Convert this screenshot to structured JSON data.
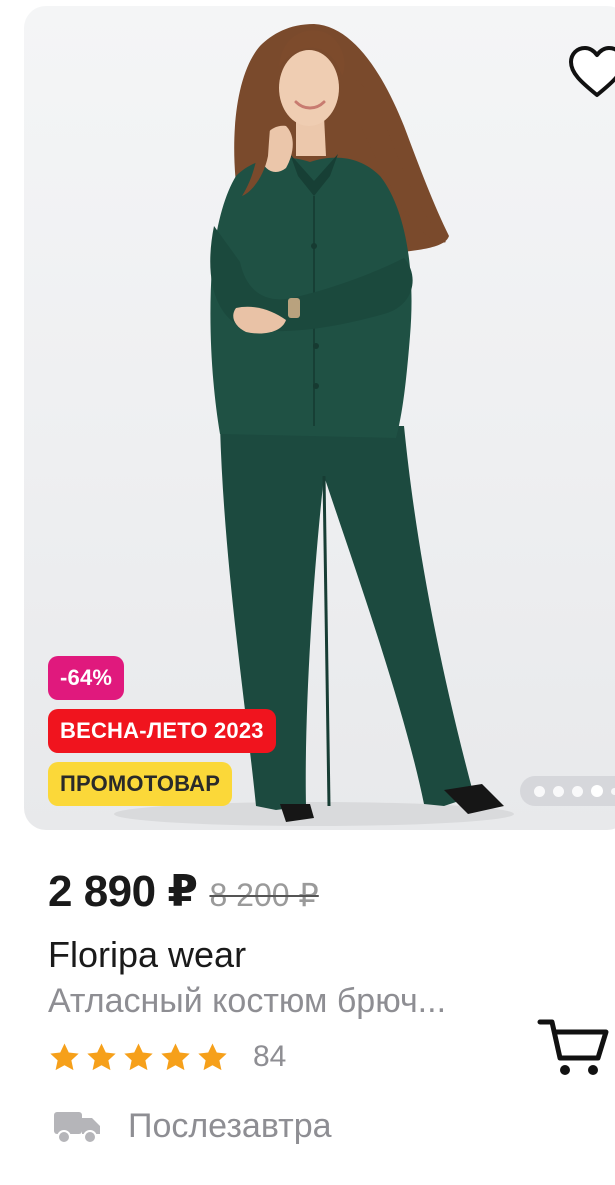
{
  "product": {
    "price": "2 890 ₽",
    "old_price": "8 200 ₽",
    "brand": "Floripa wear",
    "title": "Атласный костюм брюч...",
    "rating_count": "84",
    "rating_stars": 5,
    "delivery": "Послезавтра"
  },
  "badges": {
    "discount": "-64%",
    "season": "ВЕСНА-ЛЕТО 2023",
    "promo": "ПРОМОТОВАР"
  },
  "gallery": {
    "total_images": 5,
    "active_index": 3
  },
  "icons": {
    "favorite": "heart-outline-icon",
    "cart": "shopping-cart-icon",
    "delivery": "truck-icon",
    "star": "star-icon"
  },
  "colors": {
    "discount_badge": "#e0197d",
    "season_badge": "#f0141e",
    "promo_badge": "#fbd839",
    "star": "#f6a01a",
    "outfit": "#1e4a3f"
  }
}
